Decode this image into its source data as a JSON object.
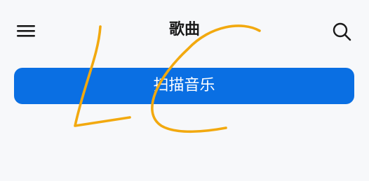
{
  "header": {
    "title": "歌曲",
    "menu_icon": "hamburger-menu-icon",
    "search_icon": "search-icon"
  },
  "main": {
    "scan_button_label": "扫描音乐"
  },
  "colors": {
    "background": "#f7f8fa",
    "accent": "#0a6fe3",
    "ink": "#1a1a1a",
    "doodle": "#f2a90f"
  }
}
